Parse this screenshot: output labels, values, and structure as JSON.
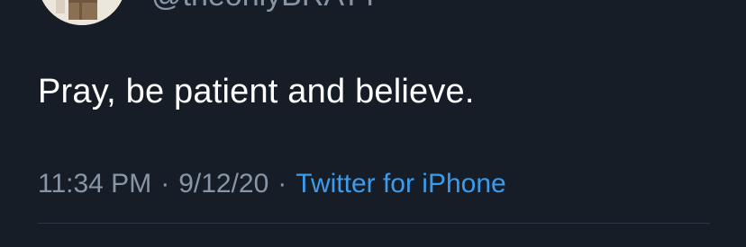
{
  "tweet": {
    "handle": "@theonlyBRATT",
    "text": "Pray, be patient and believe.",
    "time": "11:34 PM",
    "date": "9/12/20",
    "separator": "·",
    "source": "Twitter for iPhone"
  },
  "colors": {
    "background": "#161d27",
    "text": "#ffffff",
    "muted": "#8796a6",
    "link": "#3b9bed"
  },
  "icons": {
    "avatar": "profile-avatar"
  }
}
